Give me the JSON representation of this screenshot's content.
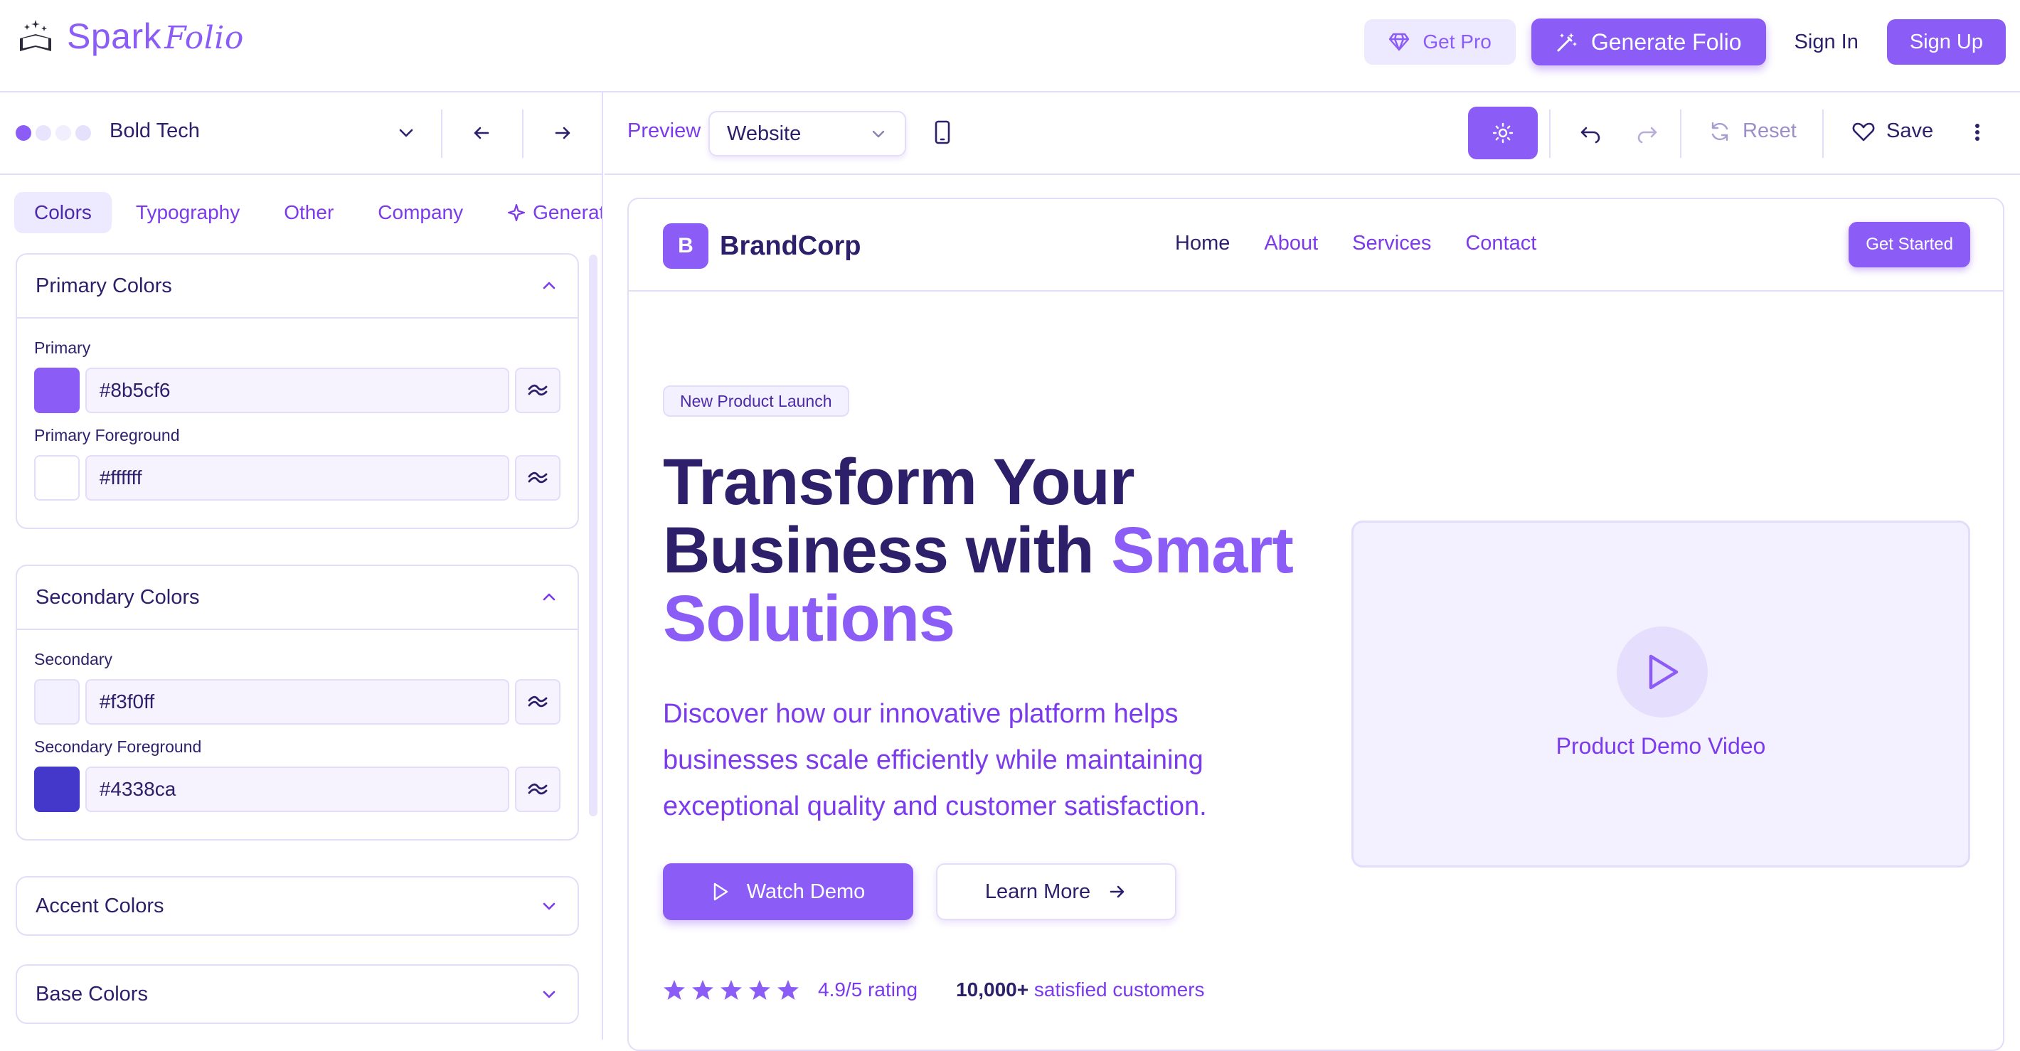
{
  "header": {
    "logo_text": "Spark",
    "logo_script": "Folio",
    "get_pro": "Get Pro",
    "generate": "Generate Folio",
    "sign_in": "Sign In",
    "sign_up": "Sign Up"
  },
  "theme": {
    "name": "Bold Tech",
    "dot_colors": [
      "#8b5cf6",
      "#e9e4fd",
      "#f1eefe",
      "#e5e0fb"
    ]
  },
  "tabs": [
    {
      "label": "Colors",
      "active": true
    },
    {
      "label": "Typography"
    },
    {
      "label": "Other"
    },
    {
      "label": "Company"
    },
    {
      "label": "Generate"
    }
  ],
  "sections": {
    "primary": {
      "title": "Primary Colors",
      "fields": [
        {
          "label": "Primary",
          "value": "#8b5cf6"
        },
        {
          "label": "Primary Foreground",
          "value": "#ffffff"
        }
      ]
    },
    "secondary": {
      "title": "Secondary Colors",
      "fields": [
        {
          "label": "Secondary",
          "value": "#f3f0ff"
        },
        {
          "label": "Secondary Foreground",
          "value": "#4338ca"
        }
      ]
    },
    "accent": {
      "title": "Accent Colors"
    },
    "base": {
      "title": "Base Colors"
    }
  },
  "preview_toolbar": {
    "label": "Preview",
    "mode": "Website",
    "reset": "Reset",
    "save": "Save"
  },
  "site": {
    "brand_mark": "B",
    "brand_name": "BrandCorp",
    "nav": [
      "Home",
      "About",
      "Services",
      "Contact"
    ],
    "cta": "Get Started",
    "badge": "New Product Launch",
    "headline_1": "Transform Your",
    "headline_2": "Business with ",
    "headline_accent_1": "Smart",
    "headline_accent_2": "Solutions",
    "subtext": "Discover how our innovative platform helps businesses scale efficiently while maintaining exceptional quality and customer satisfaction.",
    "watch_demo": "Watch Demo",
    "learn_more": "Learn More",
    "rating": "4.9/5 rating",
    "rating_stars": 5,
    "customers_count": "10,000+",
    "customers_text": " satisfied customers",
    "video_label": "Product Demo Video"
  }
}
